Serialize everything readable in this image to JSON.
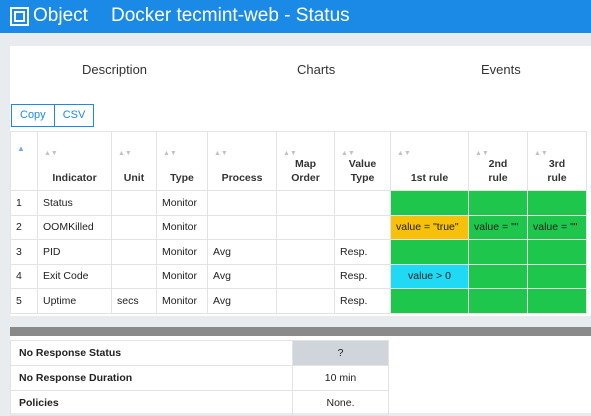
{
  "header": {
    "object_label": "Object",
    "title": "Docker tecmint-web - Status"
  },
  "tabs": [
    {
      "label": "Description"
    },
    {
      "label": "Charts"
    },
    {
      "label": "Events"
    }
  ],
  "toolbar": {
    "copy_label": "Copy",
    "csv_label": "CSV"
  },
  "table": {
    "sort_up_glyph": "▲",
    "sort_both_glyph": "▲▼",
    "columns": [
      {
        "l1": "",
        "l2": ""
      },
      {
        "l1": "",
        "l2": "Indicator"
      },
      {
        "l1": "",
        "l2": "Unit"
      },
      {
        "l1": "",
        "l2": "Type"
      },
      {
        "l1": "",
        "l2": "Process"
      },
      {
        "l1": "Map",
        "l2": "Order"
      },
      {
        "l1": "Value",
        "l2": "Type"
      },
      {
        "l1": "",
        "l2": "1st rule"
      },
      {
        "l1": "2nd",
        "l2": "rule"
      },
      {
        "l1": "3rd",
        "l2": "rule"
      }
    ],
    "rows": [
      {
        "num": "1",
        "indicator": "Status",
        "unit": "",
        "type": "Monitor",
        "process": "",
        "map_order": "",
        "value_type": "",
        "r1": "",
        "r2": "",
        "r3": ""
      },
      {
        "num": "2",
        "indicator": "OOMKilled",
        "unit": "",
        "type": "Monitor",
        "process": "",
        "map_order": "",
        "value_type": "",
        "r1": "value = \"true\"",
        "r2": "value = \"\"",
        "r3": "value = \"\""
      },
      {
        "num": "3",
        "indicator": "PID",
        "unit": "",
        "type": "Monitor",
        "process": "Avg",
        "map_order": "",
        "value_type": "Resp.",
        "r1": "",
        "r2": "",
        "r3": ""
      },
      {
        "num": "4",
        "indicator": "Exit Code",
        "unit": "",
        "type": "Monitor",
        "process": "Avg",
        "map_order": "",
        "value_type": "Resp.",
        "r1": "value > 0",
        "r2": "",
        "r3": ""
      },
      {
        "num": "5",
        "indicator": "Uptime",
        "unit": "secs",
        "type": "Monitor",
        "process": "Avg",
        "map_order": "",
        "value_type": "Resp.",
        "r1": "",
        "r2": "",
        "r3": ""
      }
    ]
  },
  "properties": [
    {
      "label": "No Response Status",
      "value": "?"
    },
    {
      "label": "No Response Duration",
      "value": "10 min"
    },
    {
      "label": "Policies",
      "value": "None."
    }
  ],
  "colors": {
    "header_blue": "#1a8ae6",
    "rule_ok_green": "#1ec64b",
    "rule_warning_yellow": "#f6c00b",
    "rule_info_cyan": "#1fd9f5",
    "unknown_grey": "#cfd5da"
  }
}
